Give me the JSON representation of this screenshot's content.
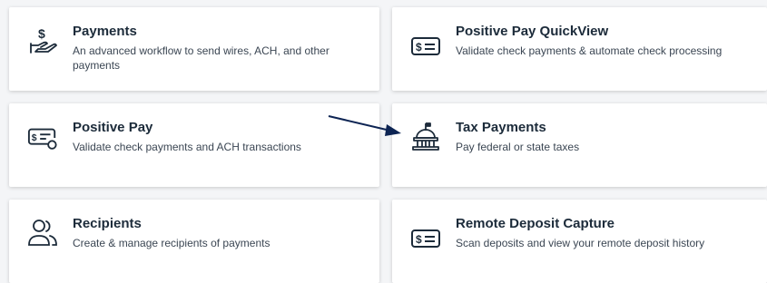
{
  "cards": [
    {
      "title": "Payments",
      "description": "An advanced workflow to send wires, ACH, and other payments",
      "icon": "hand-dollar-icon"
    },
    {
      "title": "Positive Pay QuickView",
      "description": "Validate check payments & automate check processing",
      "icon": "dollar-bill-icon"
    },
    {
      "title": "Positive Pay",
      "description": "Validate check payments and ACH transactions",
      "icon": "check-validate-icon"
    },
    {
      "title": "Tax Payments",
      "description": "Pay federal or state taxes",
      "icon": "government-building-icon"
    },
    {
      "title": "Recipients",
      "description": "Create & manage recipients of payments",
      "icon": "people-icon"
    },
    {
      "title": "Remote Deposit Capture",
      "description": "Scan deposits and view your remote deposit history",
      "icon": "dollar-bill-icon"
    }
  ],
  "colors": {
    "text": "#1c2b3a",
    "icon": "#1c2b3a",
    "arrow": "#0d2453"
  }
}
